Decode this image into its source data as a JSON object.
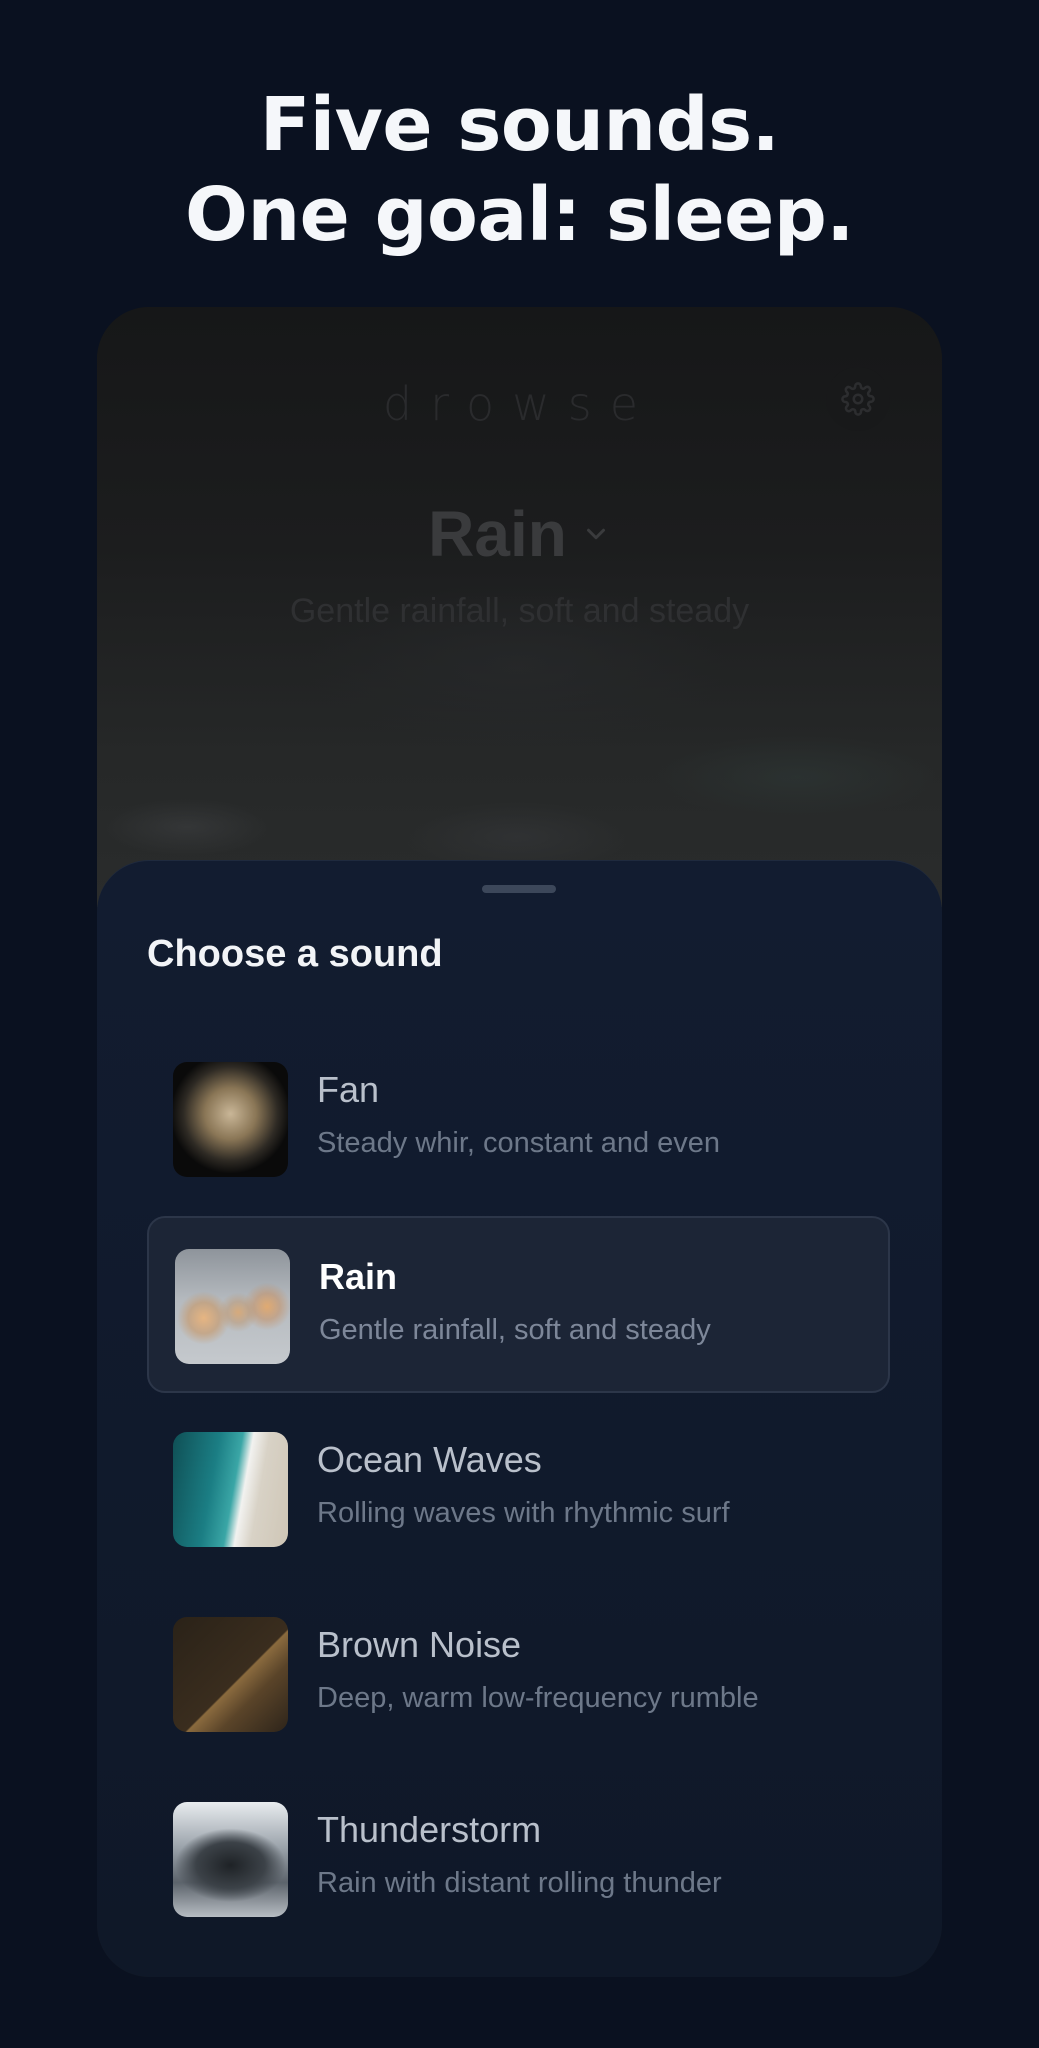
{
  "headline": {
    "line1": "Five sounds.",
    "line2": "One goal: sleep."
  },
  "app": {
    "brand": "drowse",
    "current_sound": "Rain",
    "current_sound_description": "Gentle rainfall, soft and steady",
    "settings_icon": "gear-icon",
    "dropdown_icon": "chevron-down-icon"
  },
  "sheet": {
    "title": "Choose a sound",
    "items": [
      {
        "name": "Fan",
        "description": "Steady whir, constant and even",
        "selected": false
      },
      {
        "name": "Rain",
        "description": "Gentle rainfall, soft and steady",
        "selected": true
      },
      {
        "name": "Ocean Waves",
        "description": "Rolling waves with rhythmic surf",
        "selected": false
      },
      {
        "name": "Brown Noise",
        "description": "Deep, warm low-frequency rumble",
        "selected": false
      },
      {
        "name": "Thunderstorm",
        "description": "Rain with distant rolling thunder",
        "selected": false
      }
    ]
  },
  "colors": {
    "background": "#0a1120",
    "sheet": "#121c30",
    "selected_row": "#1c2536",
    "headline_text": "#f5f7fa"
  }
}
